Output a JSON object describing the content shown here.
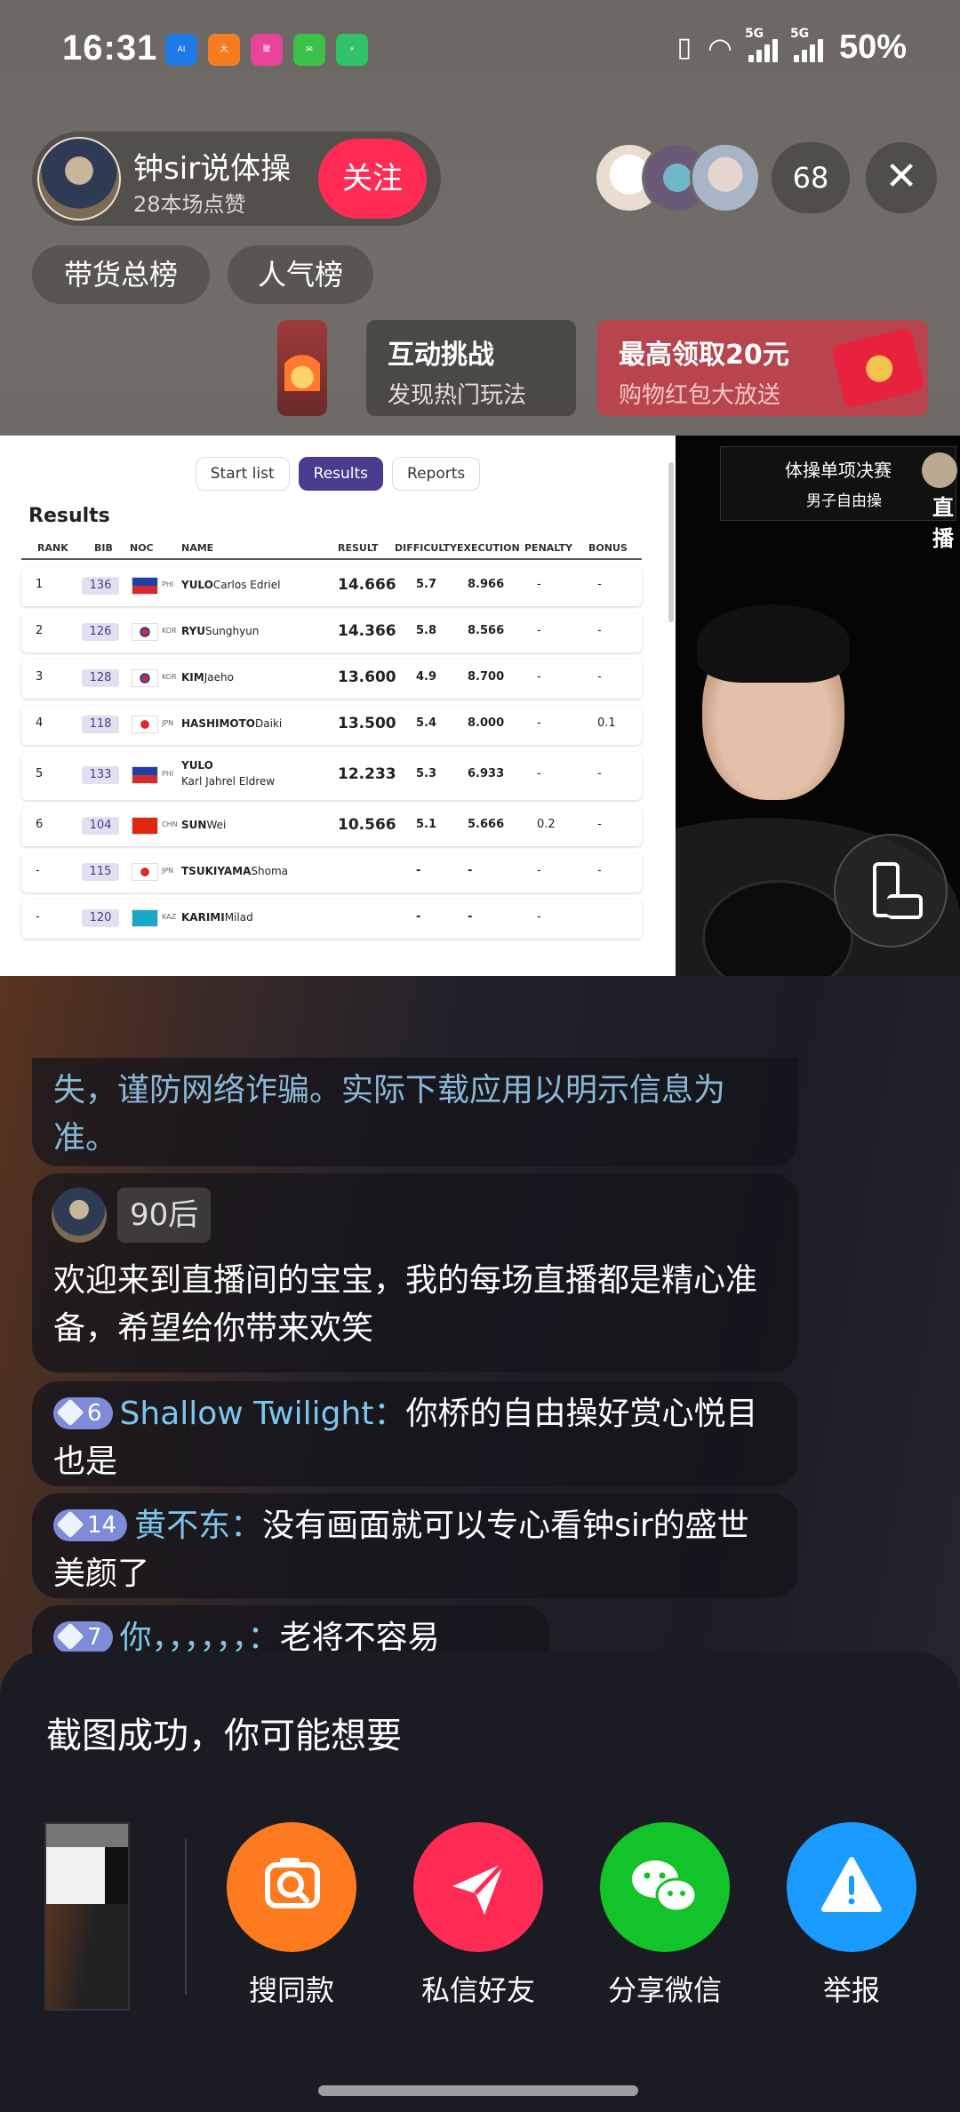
{
  "status_bar": {
    "time": "16:31",
    "battery": "50%",
    "network_1": "5G",
    "network_2": "5G"
  },
  "host": {
    "name": "钟sir说体操",
    "likes": "28本场点赞",
    "follow_label": "关注"
  },
  "viewers": {
    "count": "68"
  },
  "rank_chips": [
    "带货总榜",
    "人气榜"
  ],
  "promos": [
    {
      "title": "互动挑战",
      "subtitle": "发现热门玩法"
    },
    {
      "title": "最高领取20元",
      "subtitle": "购物红包大放送"
    }
  ],
  "results": {
    "tabs": [
      "Start list",
      "Results",
      "Reports"
    ],
    "active_tab": "Results",
    "title": "Results",
    "columns": [
      "RANK",
      "BIB",
      "NOC",
      "NAME",
      "RESULT",
      "DIFFICULTY",
      "EXECUTION",
      "PENALTY",
      "BONUS"
    ],
    "rows": [
      {
        "rank": "1",
        "bib": "136",
        "noc": "PHI",
        "surname": "YULO",
        "given": "Carlos Edriel",
        "result": "14.666",
        "difficulty": "5.7",
        "execution": "8.966",
        "penalty": "-",
        "bonus": "-"
      },
      {
        "rank": "2",
        "bib": "126",
        "noc": "KOR",
        "surname": "RYU",
        "given": "Sunghyun",
        "result": "14.366",
        "difficulty": "5.8",
        "execution": "8.566",
        "penalty": "-",
        "bonus": "-"
      },
      {
        "rank": "3",
        "bib": "128",
        "noc": "KOR",
        "surname": "KIM",
        "given": "Jaeho",
        "result": "13.600",
        "difficulty": "4.9",
        "execution": "8.700",
        "penalty": "-",
        "bonus": "-"
      },
      {
        "rank": "4",
        "bib": "118",
        "noc": "JPN",
        "surname": "HASHIMOTO",
        "given": "Daiki",
        "result": "13.500",
        "difficulty": "5.4",
        "execution": "8.000",
        "penalty": "-",
        "bonus": "0.1"
      },
      {
        "rank": "5",
        "bib": "133",
        "noc": "PHI",
        "surname": "YULO",
        "given": "Karl Jahrel Eldrew",
        "result": "12.233",
        "difficulty": "5.3",
        "execution": "6.933",
        "penalty": "-",
        "bonus": "-"
      },
      {
        "rank": "6",
        "bib": "104",
        "noc": "CHN",
        "surname": "SUN",
        "given": "Wei",
        "result": "10.566",
        "difficulty": "5.1",
        "execution": "5.666",
        "penalty": "0.2",
        "bonus": "-"
      },
      {
        "rank": "-",
        "bib": "115",
        "noc": "JPN",
        "surname": "TSUKIYAMA",
        "given": "Shoma",
        "result": "",
        "difficulty": "-",
        "execution": "-",
        "penalty": "-",
        "bonus": "-"
      },
      {
        "rank": "-",
        "bib": "120",
        "noc": "KAZ",
        "surname": "KARIMI",
        "given": "Milad",
        "result": "",
        "difficulty": "-",
        "execution": "-",
        "penalty": "-",
        "bonus": ""
      }
    ]
  },
  "cam_badge": {
    "title": "体操单项决赛",
    "subtitle": "男子自由操",
    "live": "直播"
  },
  "chat": {
    "warning": "失，谨防网络诈骗。实际下载应用以明示信息为准。",
    "host_tag": "90后",
    "host_message": "欢迎来到直播间的宝宝，我的每场直播都是精心准备，希望给你带来欢笑",
    "messages": [
      {
        "level": "6",
        "user": "Shallow Twilight：",
        "text": "你桥的自由操好赏心悦目也是"
      },
      {
        "level": "14",
        "user": "黄不东：",
        "text": "没有画面就可以专心看钟sir的盛世美颜了"
      },
      {
        "level": "7",
        "user": "你，，，，，，：",
        "text": "老将不容易"
      }
    ]
  },
  "sheet": {
    "title": "截图成功，你可能想要",
    "actions": [
      {
        "label": "搜同款",
        "color": "#fe7a1f",
        "icon": "camera-search-icon"
      },
      {
        "label": "私信好友",
        "color": "#fe2c55",
        "icon": "paper-plane-icon"
      },
      {
        "label": "分享微信",
        "color": "#12c329",
        "icon": "wechat-icon"
      },
      {
        "label": "举报",
        "color": "#1a9bff",
        "icon": "warning-icon"
      }
    ]
  }
}
